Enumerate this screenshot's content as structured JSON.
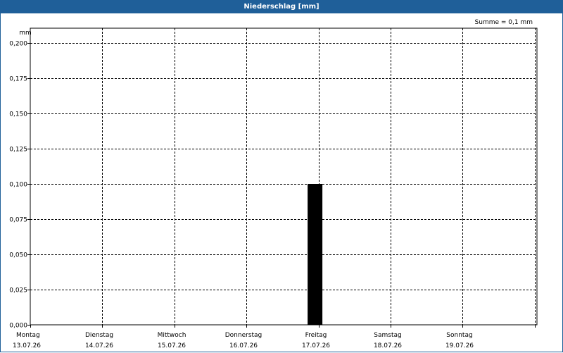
{
  "window": {
    "title": "Niederschlag [mm]",
    "sum_label": "Summe = 0,1 mm"
  },
  "colors": {
    "title_bar": "#1f5f99",
    "bar": "#000000",
    "grid": "#000000"
  },
  "chart_data": {
    "type": "bar",
    "title": "Niederschlag [mm]",
    "ylabel": "mm",
    "ylim": [
      0,
      0.2
    ],
    "yticks": [
      {
        "value": 0.0,
        "label": "0,000"
      },
      {
        "value": 0.025,
        "label": "0,025"
      },
      {
        "value": 0.05,
        "label": "0,050"
      },
      {
        "value": 0.075,
        "label": "0,075"
      },
      {
        "value": 0.1,
        "label": "0,100"
      },
      {
        "value": 0.125,
        "label": "0,125"
      },
      {
        "value": 0.15,
        "label": "0,150"
      },
      {
        "value": 0.175,
        "label": "0,175"
      },
      {
        "value": 0.2,
        "label": "0,200"
      }
    ],
    "days": [
      {
        "day": "Montag",
        "date": "13.07.26"
      },
      {
        "day": "Dienstag",
        "date": "14.07.26"
      },
      {
        "day": "Mittwoch",
        "date": "15.07.26"
      },
      {
        "day": "Donnerstag",
        "date": "16.07.26"
      },
      {
        "day": "Freitag",
        "date": "17.07.26"
      },
      {
        "day": "Samstag",
        "date": "18.07.26"
      },
      {
        "day": "Sonntag",
        "date": "19.07.26"
      }
    ],
    "bars": [
      {
        "date": "16.07.26",
        "position": "end of day",
        "value": 0.1
      }
    ],
    "grid": true
  }
}
